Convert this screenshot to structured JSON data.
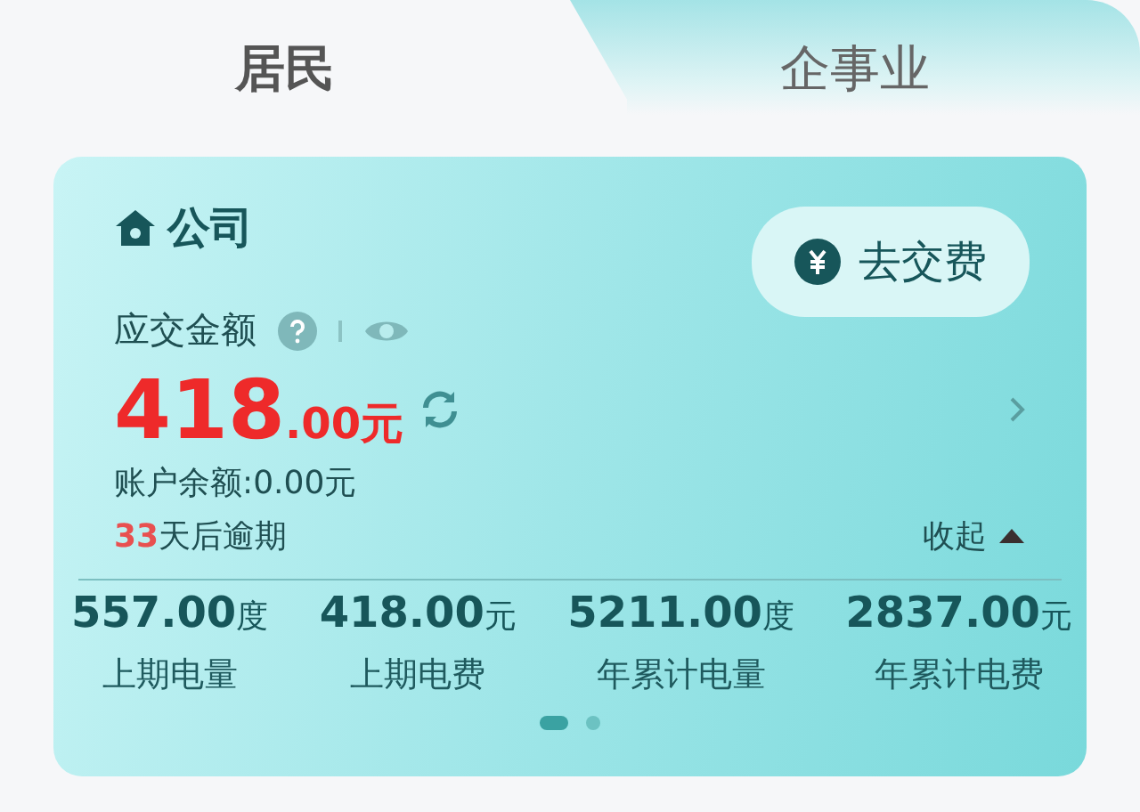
{
  "tabs": [
    {
      "label": "居民",
      "selected": true
    },
    {
      "label": "企事业",
      "selected": false
    }
  ],
  "account": {
    "name": "公司",
    "pay_button": "去交费",
    "amount_label": "应交金额",
    "amount_integer": "418",
    "amount_decimal": ".00元",
    "balance": "账户余额:0.00元",
    "overdue_days": "33",
    "overdue_suffix": "天后逾期",
    "collapse": "收起"
  },
  "stats": [
    {
      "value": "557.00",
      "unit": "度",
      "label": "上期电量"
    },
    {
      "value": "418.00",
      "unit": "元",
      "label": "上期电费"
    },
    {
      "value": "5211.00",
      "unit": "度",
      "label": "年累计电量"
    },
    {
      "value": "2837.00",
      "unit": "元",
      "label": "年累计电费"
    }
  ],
  "pager": [
    {
      "selected": true
    },
    {
      "selected": false
    }
  ]
}
